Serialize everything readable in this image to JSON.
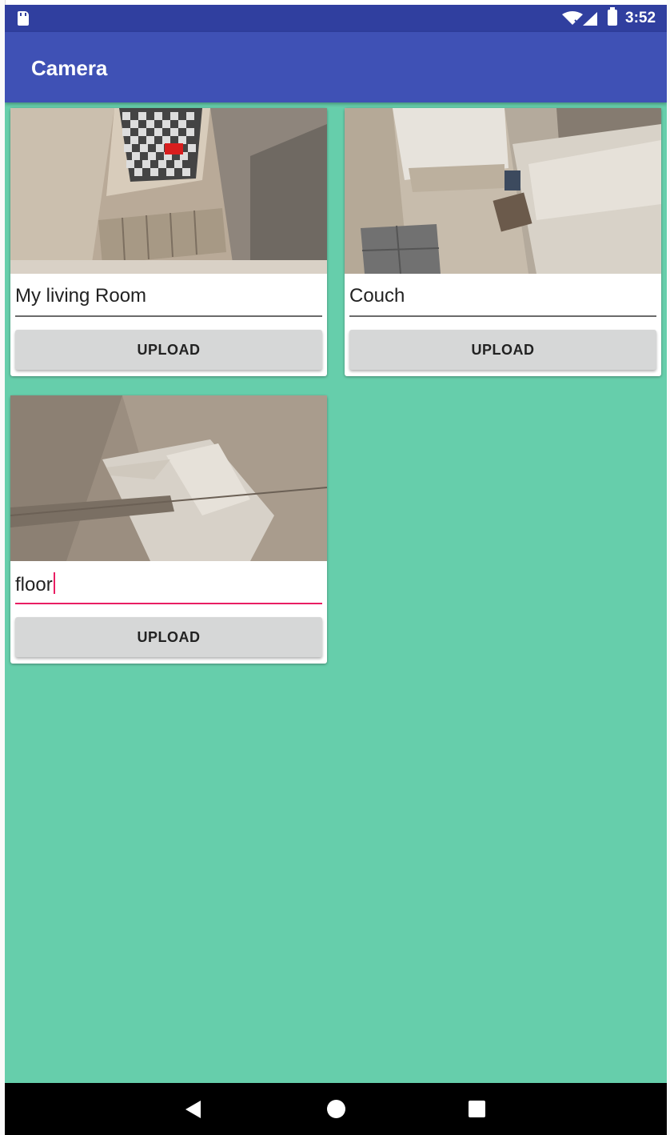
{
  "status_bar": {
    "time": "3:52",
    "icons": [
      "sd-card-icon",
      "wifi-icon",
      "signal-icon",
      "battery-icon"
    ]
  },
  "app_bar": {
    "title": "Camera",
    "color": "#3f51b5"
  },
  "colors": {
    "background": "#66ceab",
    "status_bar": "#303f9f",
    "accent": "#e91e63"
  },
  "cards": [
    {
      "image": "living room photo",
      "title_value": "My living Room",
      "upload_label": "UPLOAD",
      "focused": false
    },
    {
      "image": "couch photo",
      "title_value": "Couch",
      "upload_label": "UPLOAD",
      "focused": false
    },
    {
      "image": "floor photo",
      "title_value": "floor",
      "upload_label": "UPLOAD",
      "focused": true
    }
  ],
  "nav_bar": {
    "buttons": [
      "back-icon",
      "home-icon",
      "recents-icon"
    ]
  }
}
